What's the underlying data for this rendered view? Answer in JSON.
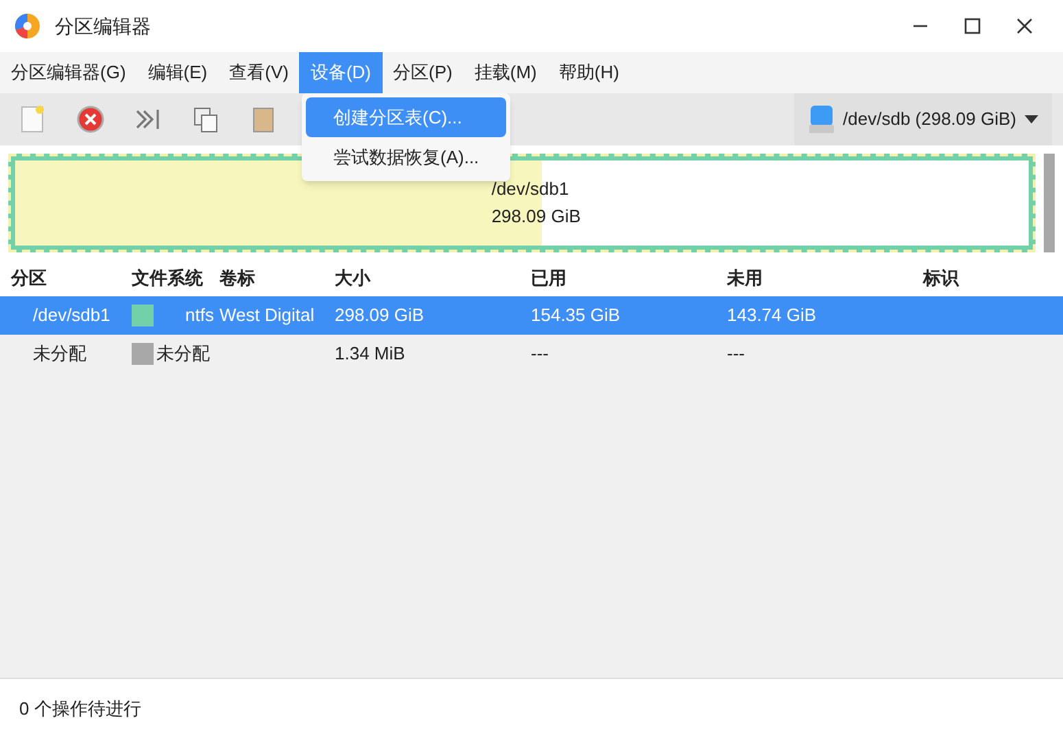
{
  "window": {
    "title": "分区编辑器"
  },
  "menu_bar": [
    {
      "label": "分区编辑器(G)",
      "selected": false
    },
    {
      "label": "编辑(E)",
      "selected": false
    },
    {
      "label": "查看(V)",
      "selected": false
    },
    {
      "label": "设备(D)",
      "selected": true
    },
    {
      "label": "分区(P)",
      "selected": false
    },
    {
      "label": "挂载(M)",
      "selected": false
    },
    {
      "label": "帮助(H)",
      "selected": false
    }
  ],
  "open_menu": [
    {
      "label": "创建分区表(C)...",
      "selected": true
    },
    {
      "label": "尝试数据恢复(A)...",
      "selected": false
    }
  ],
  "device_selector": {
    "value": "/dev/sdb (298.09 GiB)"
  },
  "disk_map": [
    {
      "kind": "partition",
      "name": "/dev/sdb1",
      "size": "298.09 GiB",
      "color": "#72d1a8",
      "level": 0.52,
      "selected": true
    },
    {
      "kind": "unallocated",
      "color": "#a8a8a8",
      "selected": false
    }
  ],
  "table": {
    "columns": [
      "分区",
      "文件系统",
      "卷标",
      "大小",
      "已用",
      "未用",
      "标识"
    ],
    "rows": [
      {
        "partition": "/dev/sdb1",
        "filesystem": "ntfs",
        "color": "#72d1a8",
        "label": "West Digital",
        "size": "298.09 GiB",
        "used": "154.35 GiB",
        "unused": "143.74 GiB",
        "selected": true
      },
      {
        "partition": "未分配",
        "filesystem": "未分配",
        "color": "#a8a8a8",
        "size": "1.34 MiB",
        "used": "---",
        "unused": "---",
        "selected": false
      }
    ]
  },
  "status_bar": "0 个操作待进行"
}
